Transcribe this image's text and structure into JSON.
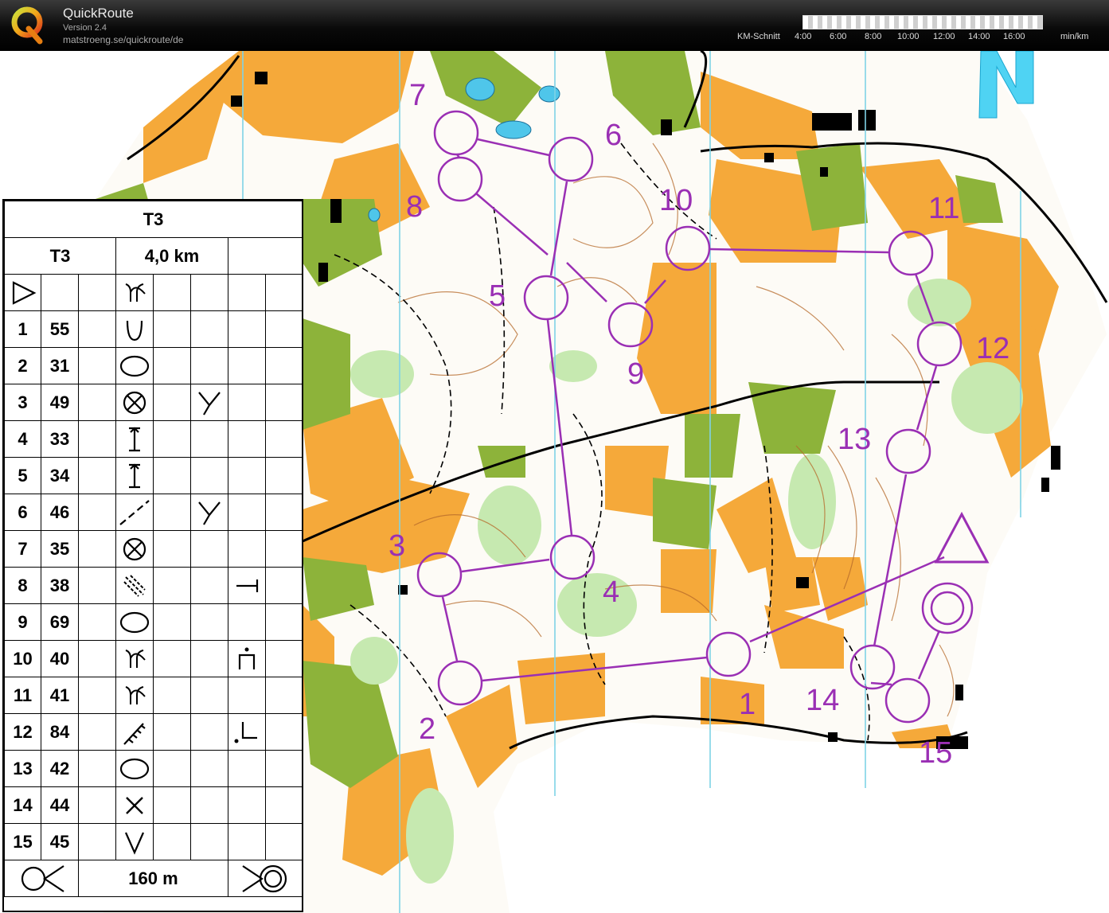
{
  "app": {
    "title": "QuickRoute",
    "version": "Version 2.4",
    "url": "matstroeng.se/quickroute/de"
  },
  "pace_scale": {
    "label": "KM-Schnitt",
    "ticks": [
      "4:00",
      "6:00",
      "8:00",
      "10:00",
      "12:00",
      "14:00",
      "16:00"
    ],
    "unit": "min/km"
  },
  "map": {
    "north_label": "N",
    "course_color": "#9a2fb4",
    "control_labels": [
      "1",
      "2",
      "3",
      "4",
      "5",
      "6",
      "7",
      "8",
      "9",
      "10",
      "11",
      "12",
      "13",
      "14",
      "15"
    ],
    "colors": {
      "open": "#f5a93a",
      "green": "#8db33a",
      "light_green": "#c6e9b0",
      "contour": "#b66a2a",
      "magnetic_lines": "#7fd3e6"
    }
  },
  "description_sheet": {
    "title": "T3",
    "course_name": "T3",
    "course_length": "4,0 km",
    "rows": [
      {
        "num": "",
        "code": "",
        "symbol": "start-triangle",
        "c5": "",
        "c6": "",
        "c7": "",
        "c8": ""
      },
      {
        "num": "1",
        "code": "55",
        "symbol": "reentrant",
        "c5": "",
        "c6": "",
        "c7": "",
        "c8": ""
      },
      {
        "num": "2",
        "code": "31",
        "symbol": "knoll",
        "c5": "",
        "c6": "",
        "c7": "",
        "c8": ""
      },
      {
        "num": "3",
        "code": "49",
        "symbol": "path-crossing",
        "c5": "",
        "c6": "junction",
        "c7": "",
        "c8": ""
      },
      {
        "num": "4",
        "code": "33",
        "symbol": "tower",
        "c5": "",
        "c6": "",
        "c7": "",
        "c8": ""
      },
      {
        "num": "5",
        "code": "34",
        "symbol": "tower",
        "c5": "",
        "c6": "",
        "c7": "",
        "c8": ""
      },
      {
        "num": "6",
        "code": "46",
        "symbol": "path",
        "c5": "",
        "c6": "junction",
        "c7": "",
        "c8": ""
      },
      {
        "num": "7",
        "code": "35",
        "symbol": "path-crossing",
        "c5": "",
        "c6": "",
        "c7": "",
        "c8": ""
      },
      {
        "num": "8",
        "code": "38",
        "symbol": "ditch",
        "c5": "",
        "c6": "",
        "c7": "foot",
        "c8": ""
      },
      {
        "num": "9",
        "code": "69",
        "symbol": "knoll",
        "c5": "",
        "c6": "",
        "c7": "",
        "c8": ""
      },
      {
        "num": "10",
        "code": "40",
        "symbol": "spur",
        "c5": "",
        "c6": "",
        "c7": "top",
        "c8": ""
      },
      {
        "num": "11",
        "code": "41",
        "symbol": "spur",
        "c5": "",
        "c6": "",
        "c7": "",
        "c8": ""
      },
      {
        "num": "12",
        "code": "84",
        "symbol": "earth-bank",
        "c5": "",
        "c6": "",
        "c7": "corner",
        "c8": ""
      },
      {
        "num": "13",
        "code": "42",
        "symbol": "knoll",
        "c5": "",
        "c6": "",
        "c7": "",
        "c8": ""
      },
      {
        "num": "14",
        "code": "44",
        "symbol": "cross",
        "c5": "",
        "c6": "",
        "c7": "",
        "c8": ""
      },
      {
        "num": "15",
        "code": "45",
        "symbol": "v-depression",
        "c5": "",
        "c6": "",
        "c7": "",
        "c8": ""
      }
    ],
    "finish_distance": "160 m"
  }
}
